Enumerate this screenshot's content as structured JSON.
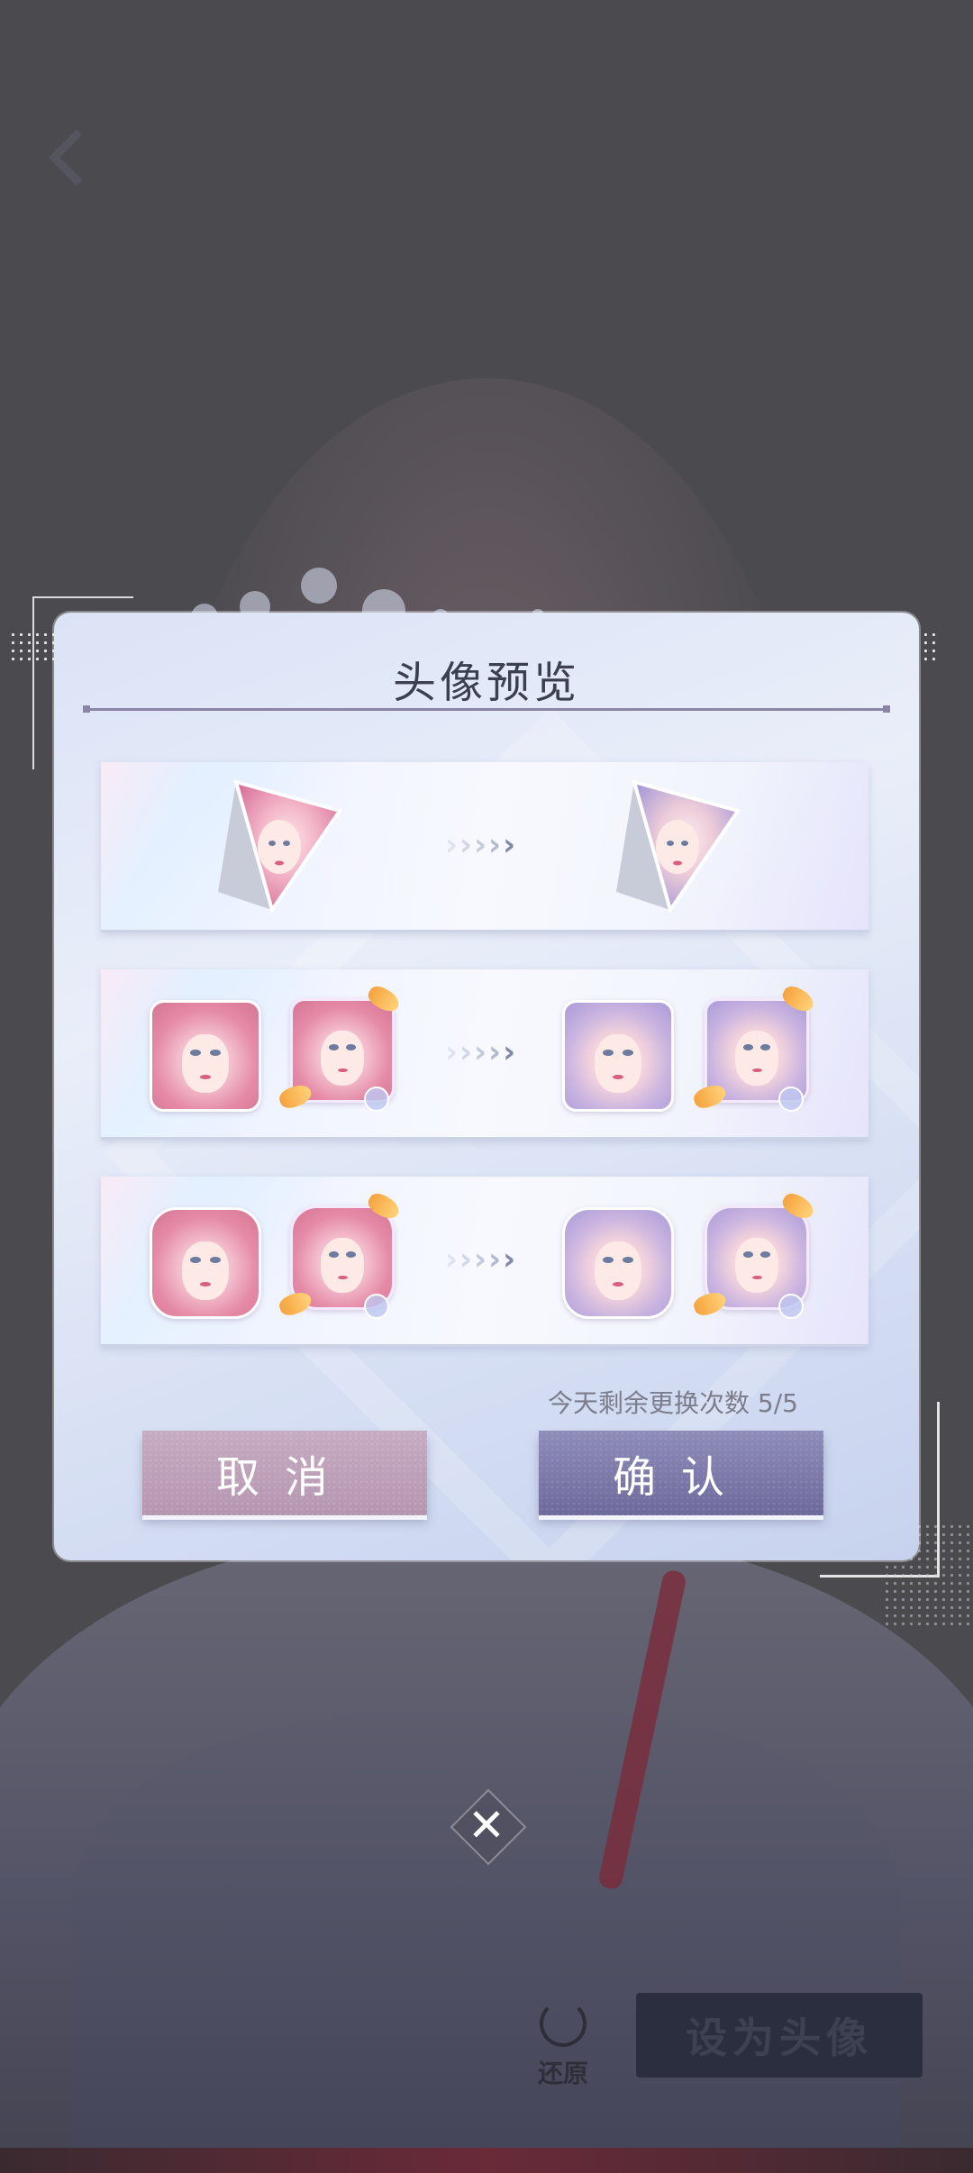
{
  "dialog": {
    "title": "头像预览",
    "remaining_text": "今天剩余更换次数 5/5",
    "cancel_label": "取消",
    "confirm_label": "确认",
    "rows": [
      {
        "name": "triangle-frame",
        "arrows": "›››››"
      },
      {
        "name": "square-avatar",
        "arrows": "›››››"
      },
      {
        "name": "round-avatar",
        "arrows": "›››››"
      }
    ]
  },
  "background": {
    "restore_label": "还原",
    "set_avatar_label": "设为头像"
  },
  "close": {
    "symbol": "✕"
  },
  "colors": {
    "dialog_bg": "#dbe3f6",
    "cancel_bg": "#c6abc2",
    "confirm_bg": "#7d7aaa",
    "title_color": "#3c3f50"
  },
  "icons": [
    "back-arrow-icon",
    "arrow-chevrons-icon",
    "close-icon",
    "restore-icon"
  ]
}
